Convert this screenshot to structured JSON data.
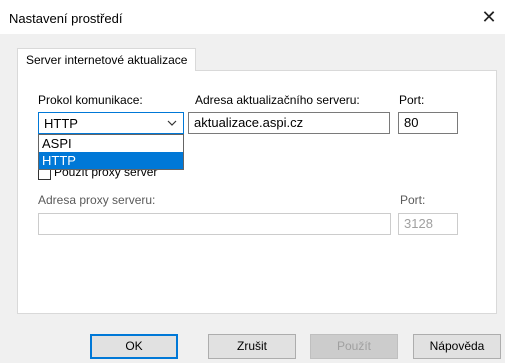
{
  "window": {
    "title": "Nastavení prostředí",
    "close_glyph": "✕"
  },
  "tab": {
    "label": "Server internetové aktualizace"
  },
  "protocol": {
    "label": "Prokol komunikace:",
    "selected": "HTTP",
    "options": [
      "ASPI",
      "HTTP"
    ],
    "highlighted_option": "HTTP"
  },
  "server": {
    "label": "Adresa aktualizačního serveru:",
    "value": "aktualizace.aspi.cz",
    "port_label": "Port:",
    "port_value": "80"
  },
  "proxy": {
    "checkbox_label": "Použít proxy server",
    "checked": false,
    "address_label": "Adresa proxy serveru:",
    "address_value": "",
    "port_label": "Port:",
    "port_value": "3128"
  },
  "buttons": {
    "ok": "OK",
    "cancel": "Zrušit",
    "apply": "Použít",
    "help": "Nápověda"
  },
  "colors": {
    "accent": "#0078d7",
    "panel_bg": "#f0f0f0"
  },
  "icons": {
    "close": "close-icon",
    "dropdown": "chevron-down-icon"
  }
}
